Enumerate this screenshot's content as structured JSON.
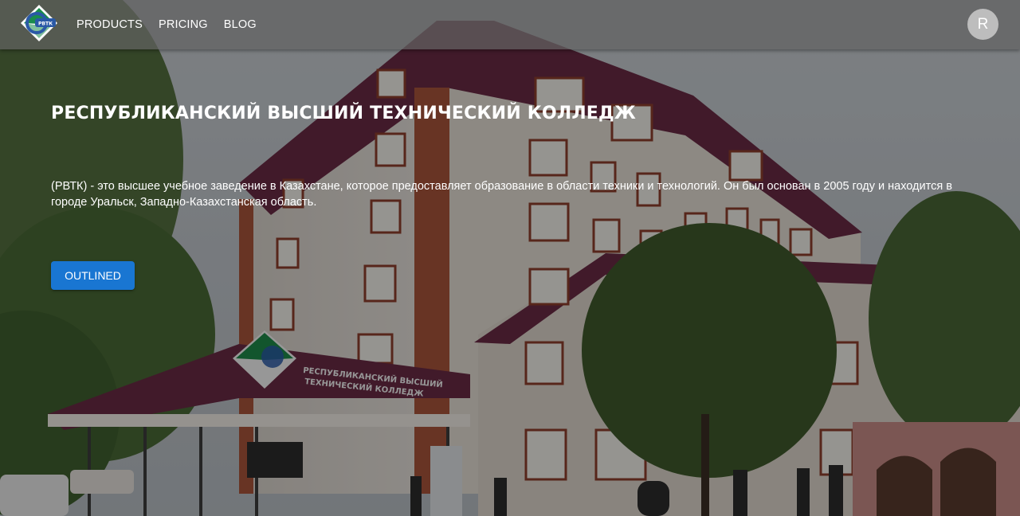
{
  "appbar": {
    "logo_text": "РВТК",
    "nav": [
      {
        "label": "PRODUCTS"
      },
      {
        "label": "PRICING"
      },
      {
        "label": "BLOG"
      }
    ],
    "avatar_letter": "R"
  },
  "hero": {
    "title": "РЕСПУБЛИКАНСКИЙ ВЫСШИЙ ТЕХНИЧЕСКИЙ КОЛЛЕДЖ",
    "description": "(РВТК) - это высшее учебное заведение в Казахстане, которое предоставляет образование в области техники и технологий. Он был основан в 2005 году и находится в городе Уральск, Западно-Казахстанская область.",
    "button_label": "OUTLINED",
    "sign_line1": "РЕСПУБЛИКАНСКИЙ ВЫСШИЙ",
    "sign_line2": "ТЕХНИЧЕСКИЙ КОЛЛЕДЖ"
  },
  "colors": {
    "primary": "#1976d2",
    "appbar": "#626262",
    "avatar": "#bdbdbd",
    "roof": "#6a2a45"
  }
}
